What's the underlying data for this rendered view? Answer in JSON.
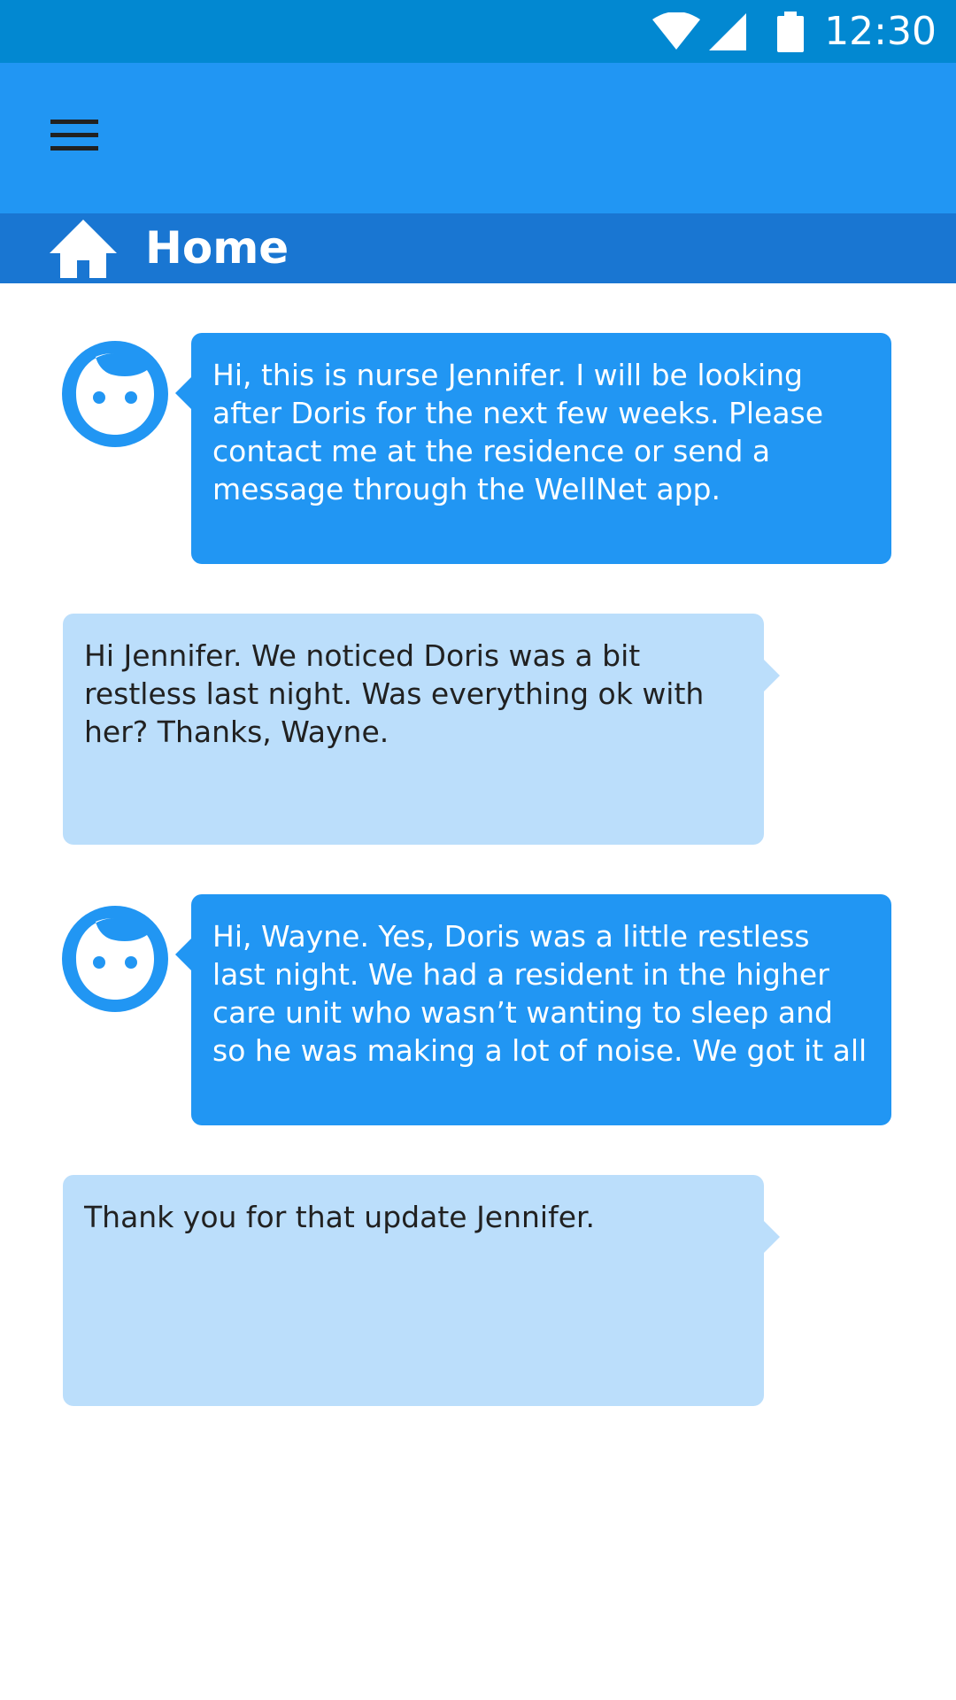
{
  "status_bar": {
    "time": "12:30",
    "icons": [
      "wifi-icon",
      "cell-signal-icon",
      "battery-icon"
    ],
    "background": "#0288D1"
  },
  "app_bar": {
    "menu_icon": "hamburger-menu-icon",
    "background": "#2196F3"
  },
  "title_bar": {
    "icon": "home-icon",
    "title": "Home",
    "background": "#1976D2"
  },
  "messages": [
    {
      "sender": "nurse",
      "avatar_icon": "face-avatar-icon",
      "text": "Hi, this is nurse Jennifer. I will be looking after Doris for the next few weeks. Please contact me at the residence or send a message through the WellNet app."
    },
    {
      "sender": "user",
      "text": "Hi Jennifer. We noticed Doris was a bit restless last night. Was everything ok with her? Thanks, Wayne."
    },
    {
      "sender": "nurse",
      "avatar_icon": "face-avatar-icon",
      "text": "Hi, Wayne. Yes, Doris was a little restless last night. We had a resident in the higher care unit who wasn’t wanting to sleep and so he was making a lot of noise. We got it all udner con-"
    },
    {
      "sender": "user",
      "text": "Thank you for that update Jennifer."
    }
  ],
  "colors": {
    "incoming_bubble": "#2196F3",
    "outgoing_bubble": "#BBDEFB",
    "avatar": "#2196F3"
  }
}
